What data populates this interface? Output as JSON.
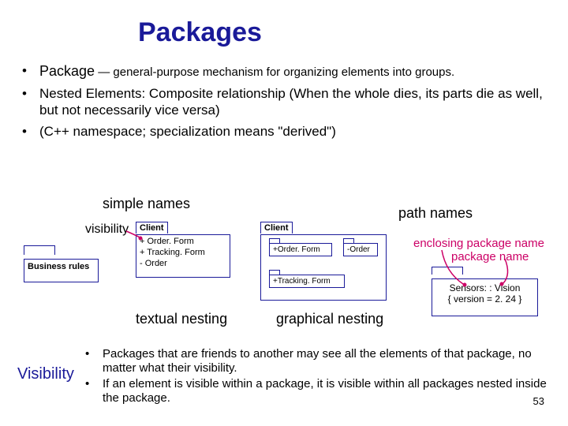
{
  "title": "Packages",
  "top_bullets": [
    {
      "term": "Package",
      "dash": " — ",
      "def": "general-purpose mechanism for organizing elements into groups."
    },
    {
      "full": "Nested Elements: Composite relationship (When the whole dies, its parts die as well, but not necessarily vice versa)"
    },
    {
      "full": "(C++ namespace; specialization means \"derived\")"
    }
  ],
  "labels": {
    "simple": "simple names",
    "path": "path names",
    "visibility": "visibility",
    "textual": "textual nesting",
    "graphical": "graphical nesting"
  },
  "biz_pkg": "Business rules",
  "client_textual": {
    "tab": "Client",
    "lines": [
      "+ Order. Form",
      "+ Tracking. Form",
      "- Order"
    ]
  },
  "client_graphical": {
    "tab": "Client",
    "inner": [
      "+Order. Form",
      "-Order",
      "+Tracking. Form"
    ]
  },
  "sensors": {
    "line1": "Sensors: : Vision",
    "line2": "{ version = 2. 24 }"
  },
  "annotations": {
    "enclosing": "enclosing package name",
    "pkgname": "package name"
  },
  "vis_head": "Visibility",
  "vis_bullets": [
    "Packages that are friends to another may see all the elements of that package, no matter what their visibility.",
    "If an element is visible within a package, it is visible within all packages nested inside the package."
  ],
  "pagenum": "53"
}
